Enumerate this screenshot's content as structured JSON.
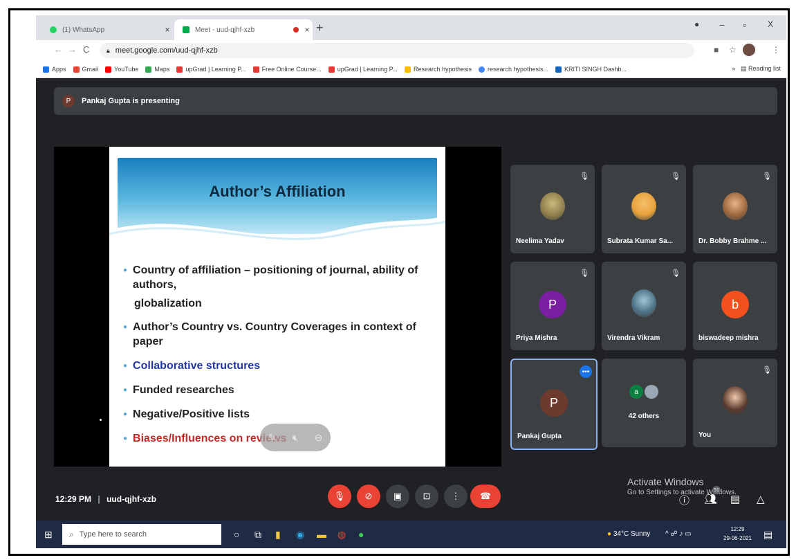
{
  "browser": {
    "tabs": [
      {
        "title": "(1) WhatsApp",
        "close": "×"
      },
      {
        "title": "Meet - uud-qjhf-xzb",
        "close": "×"
      }
    ],
    "new_tab": "+",
    "window_controls": {
      "minimize": "−",
      "maximize": "▫",
      "close": "X"
    },
    "url": "meet.google.com/uud-qjhf-xzb",
    "bookmarks": [
      {
        "label": "Apps"
      },
      {
        "label": "Gmail"
      },
      {
        "label": "YouTube"
      },
      {
        "label": "Maps"
      },
      {
        "label": "upGrad | Learning P..."
      },
      {
        "label": "Free Online Course..."
      },
      {
        "label": "upGrad | Learning P..."
      },
      {
        "label": "Research hypothesis"
      },
      {
        "label": "research hypothesis..."
      },
      {
        "label": "KRITI SINGH Dashb..."
      }
    ],
    "bookmark_more": "»",
    "reading_list": "Reading list"
  },
  "meet": {
    "presenter": {
      "initial": "P",
      "text": "Pankaj Gupta is presenting"
    },
    "slide": {
      "title": "Author’s Affiliation",
      "bullets": [
        {
          "text": "Country of affiliation – positioning of journal, ability of authors,",
          "cont": "globalization"
        },
        {
          "text": "Author’s Country vs. Country Coverages in context of paper"
        },
        {
          "text": "Collaborative structures"
        },
        {
          "text": "Funded researches"
        },
        {
          "text": "Negative/Positive lists"
        },
        {
          "text": "Biases/Influences on reviews"
        }
      ]
    },
    "participants": [
      {
        "name": "Neelima Yadav"
      },
      {
        "name": "Subrata Kumar Sa..."
      },
      {
        "name": "Dr. Bobby Brahme ..."
      },
      {
        "name": "Priya Mishra",
        "initial": "P"
      },
      {
        "name": "Virendra Vikram"
      },
      {
        "name": "biswadeep mishra",
        "initial": "b"
      },
      {
        "name": "Pankaj Gupta",
        "initial": "P"
      },
      {
        "others_initial": "a",
        "others_count": "42 others"
      },
      {
        "name": "You"
      }
    ],
    "more_icon": "•••",
    "meeting_time": "12:29 PM",
    "meeting_code": "uud-qjhf-xzb",
    "participant_badge": "51"
  },
  "windows": {
    "activate_title": "Activate Windows",
    "activate_sub": "Go to Settings to activate Windows.",
    "search_placeholder": "Type here to search",
    "weather": "34°C  Sunny",
    "time": "12:29",
    "date": "29-06-2021"
  }
}
